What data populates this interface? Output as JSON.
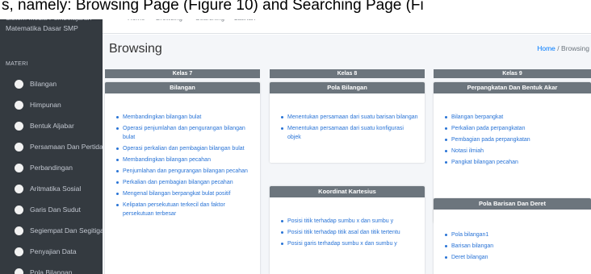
{
  "caption": "s, namely: Browsing Page (Figure 10) and Searching Page (Fi",
  "sidebar": {
    "app_title": "Sistem Media Pembelajaran Matematika Dasar SMP",
    "section_label": "MATERI",
    "items": [
      {
        "label": "Bilangan"
      },
      {
        "label": "Himpunan"
      },
      {
        "label": "Bentuk Aljabar"
      },
      {
        "label": "Persamaan Dan Pertidaksam"
      },
      {
        "label": "Perbandingan"
      },
      {
        "label": "Aritmatika Sosial"
      },
      {
        "label": "Garis Dan Sudut"
      },
      {
        "label": "Segiempat Dan Segitiga"
      },
      {
        "label": "Penyajian Data"
      },
      {
        "label": "Pola Bilangan"
      }
    ]
  },
  "topbar": {
    "menu_icon": "hamburger-icon",
    "nav": [
      {
        "label": "Home"
      },
      {
        "label": "Browsing"
      },
      {
        "label": "Searching"
      },
      {
        "label": "Latihan"
      }
    ]
  },
  "page": {
    "title": "Browsing",
    "breadcrumb": {
      "home": "Home",
      "separator": "/",
      "current": "Browsing"
    }
  },
  "columns": [
    {
      "header": "Kelas 7",
      "cards": [
        {
          "title": "Bilangan",
          "items": [
            "Membandingkan bilangan bulat",
            "Operasi penjumlahan dan pengurangan bilangan bulat",
            "Operasi perkalian dan pembagian bilangan bulat",
            "Membandingkan bilangan pecahan",
            "Penjumlahan dan pengurangan bilangan pecahan",
            "Perkalian dan pembagian bilangan pecahan",
            "Mengenal bilangan berpangkat bulat positif",
            "Kelipatan persekutuan terkecil dan faktor persekutuan terbesar"
          ]
        }
      ]
    },
    {
      "header": "Kelas 8",
      "cards": [
        {
          "title": "Pola Bilangan",
          "items": [
            "Menentukan persamaan dari suatu barisan bilangan",
            "Menentukan persamaan dari suatu konfigurasi objek"
          ]
        },
        {
          "title": "Koordinat Kartesius",
          "items": [
            "Posisi titik terhadap sumbu x dan sumbu y",
            "Posisi titik terhadap titik asal dan titik tertentu",
            "Posisi garis terhadap sumbu x dan sumbu y"
          ]
        }
      ]
    },
    {
      "header": "Kelas 9",
      "cards": [
        {
          "title": "Perpangkatan Dan Bentuk Akar",
          "items": [
            "Bilangan berpangkat",
            "Perkalian pada perpangkatan",
            "Pembagian pada perpangkatan",
            "Notasi ilmiah",
            "Pangkat bilangan pecahan"
          ]
        },
        {
          "title": "Pola Barisan Dan Deret",
          "items": [
            "Pola bilangan1",
            "Barisan bilangan",
            "Deret bilangan"
          ]
        }
      ]
    }
  ]
}
